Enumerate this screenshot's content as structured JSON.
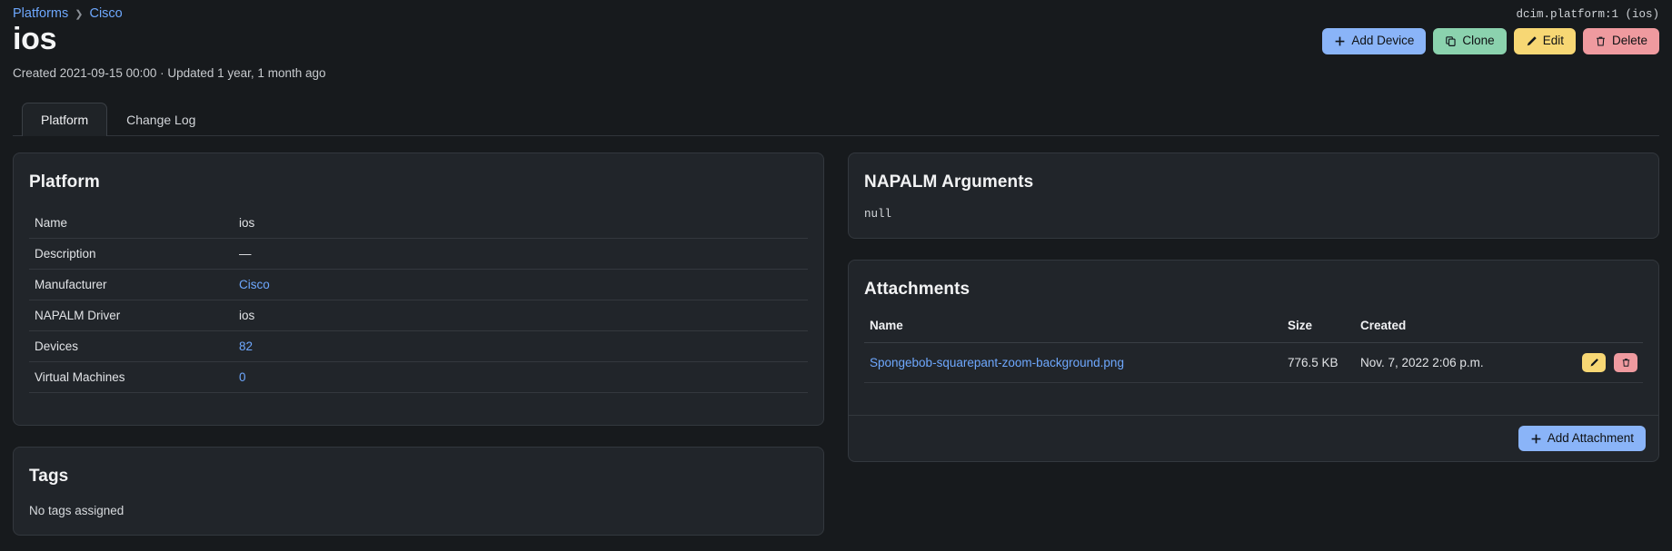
{
  "breadcrumb": {
    "items": [
      {
        "label": "Platforms",
        "href": true
      },
      {
        "label": "Cisco",
        "href": true
      }
    ],
    "separator": "❯"
  },
  "header": {
    "object_id": "dcim.platform:1 (ios)",
    "title": "ios",
    "subtitle": "Created 2021-09-15 00:00 · Updated 1 year, 1 month ago"
  },
  "actions": [
    {
      "key": "add_device",
      "label": "Add Device",
      "icon": "plus-icon",
      "color": "#8ab4f8"
    },
    {
      "key": "clone",
      "label": "Clone",
      "icon": "copy-icon",
      "color": "#8bd2ae"
    },
    {
      "key": "edit",
      "label": "Edit",
      "icon": "pencil-icon",
      "color": "#f7d774"
    },
    {
      "key": "delete",
      "label": "Delete",
      "icon": "trash-icon",
      "color": "#ef9a9f"
    }
  ],
  "tabs": [
    {
      "key": "platform",
      "label": "Platform",
      "active": true
    },
    {
      "key": "changelog",
      "label": "Change Log",
      "active": false
    }
  ],
  "platform_card": {
    "title": "Platform",
    "rows": [
      {
        "label": "Name",
        "value": "ios",
        "link": false
      },
      {
        "label": "Description",
        "value": "—",
        "link": false
      },
      {
        "label": "Manufacturer",
        "value": "Cisco",
        "link": true
      },
      {
        "label": "NAPALM Driver",
        "value": "ios",
        "link": false
      },
      {
        "label": "Devices",
        "value": "82",
        "link": true
      },
      {
        "label": "Virtual Machines",
        "value": "0",
        "link": true
      }
    ]
  },
  "tags_card": {
    "title": "Tags",
    "empty_text": "No tags assigned"
  },
  "napalm_card": {
    "title": "NAPALM Arguments",
    "content": "null"
  },
  "attachments_card": {
    "title": "Attachments",
    "columns": [
      "Name",
      "Size",
      "Created",
      ""
    ],
    "rows": [
      {
        "name": "Spongebob-squarepant-zoom-background.png",
        "size": "776.5 KB",
        "created": "Nov. 7, 2022 2:06 p.m."
      }
    ],
    "row_actions": [
      {
        "key": "edit",
        "icon": "pencil-icon",
        "color": "#f7d774"
      },
      {
        "key": "delete",
        "icon": "trash-icon",
        "color": "#ef9a9f"
      }
    ],
    "footer_button": {
      "label": "Add Attachment",
      "icon": "plus-icon",
      "color": "#8ab4f8"
    }
  },
  "theme": {
    "page_bg": "#171a1d",
    "card_bg": "#21252a",
    "card_border": "#33383e",
    "link": "#6ea8fe",
    "text": "#e3e5e8"
  }
}
